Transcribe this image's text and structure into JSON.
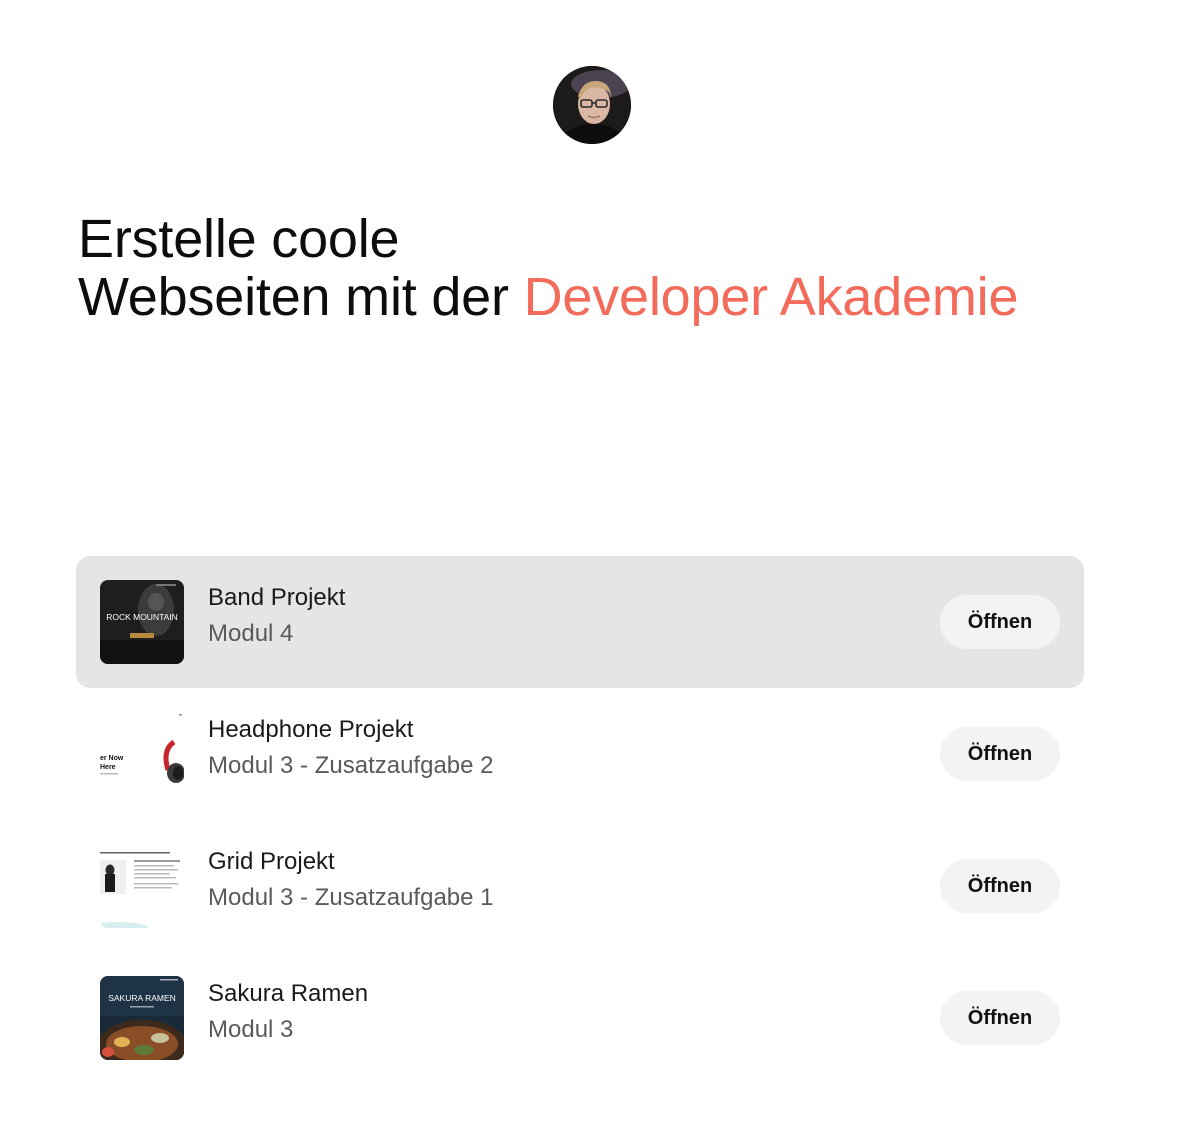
{
  "header": {
    "avatar_icon": "profile-photo"
  },
  "headline": {
    "line1": "Erstelle coole",
    "line2_prefix": "Webseiten mit der ",
    "line2_accent": "Developer Akademie",
    "accent_color": "#f26b5b"
  },
  "projects": [
    {
      "title": "Band Projekt",
      "subtitle": "Modul 4",
      "button": "Öffnen",
      "thumb_text": "ROCK MOUNTAIN",
      "active": true
    },
    {
      "title": "Headphone Projekt",
      "subtitle": "Modul 3 - Zusatzaufgabe 2",
      "button": "Öffnen",
      "thumb_text_1": "er Now",
      "thumb_text_2": "Here",
      "active": false
    },
    {
      "title": "Grid Projekt",
      "subtitle": "Modul 3 - Zusatzaufgabe 1",
      "button": "Öffnen",
      "active": false
    },
    {
      "title": "Sakura Ramen",
      "subtitle": "Modul 3",
      "button": "Öffnen",
      "thumb_text": "SAKURA RAMEN",
      "active": false
    }
  ]
}
